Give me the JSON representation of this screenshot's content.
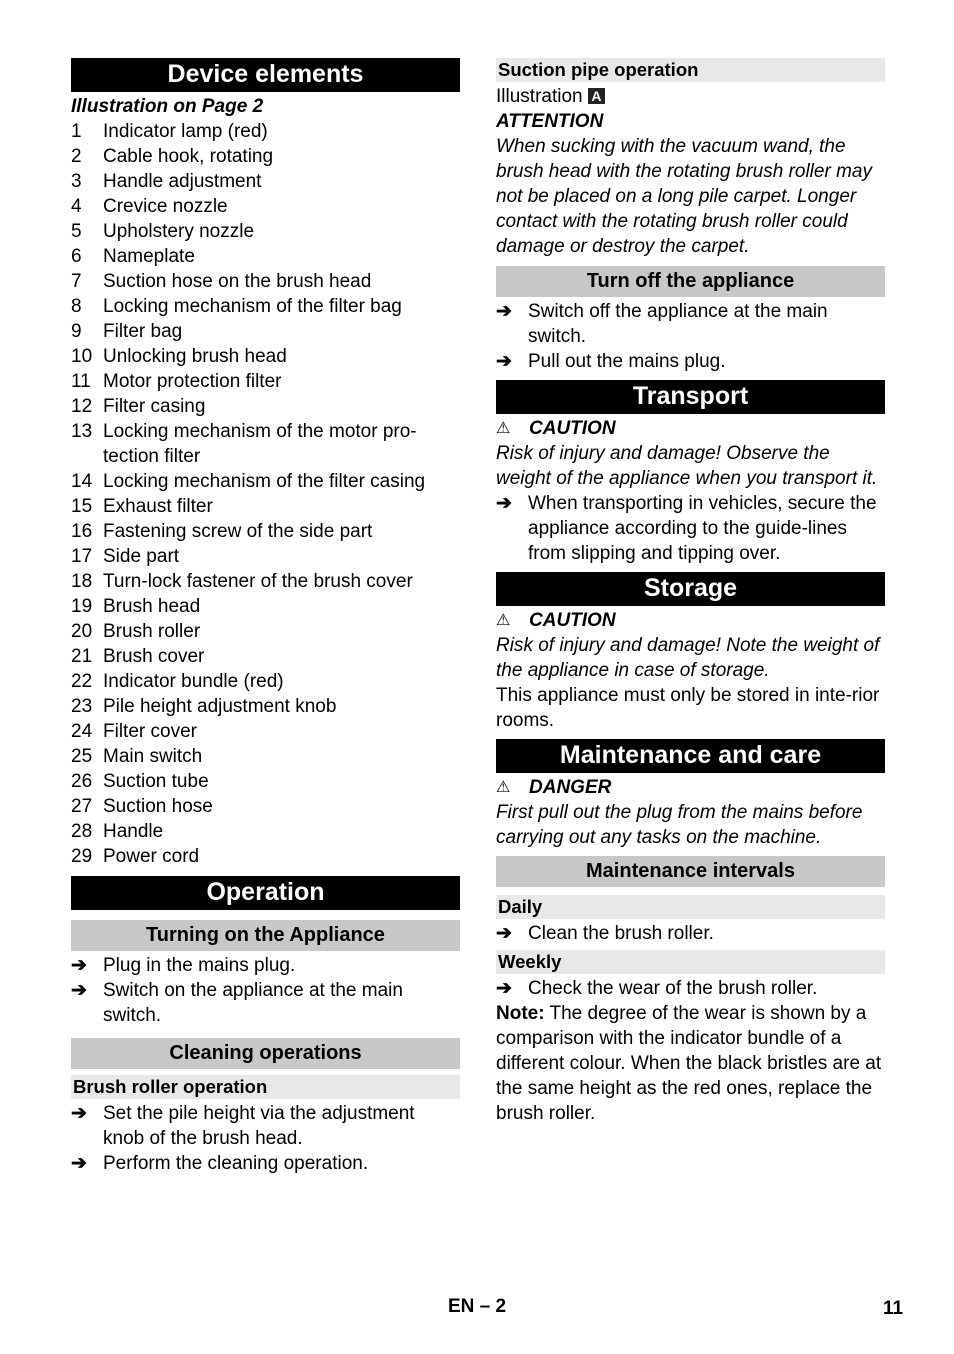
{
  "left": {
    "device_elements": {
      "title": "Device elements",
      "subtitle": "Illustration on Page 2",
      "items": [
        {
          "n": "1",
          "t": "Indicator lamp (red)"
        },
        {
          "n": "2",
          "t": "Cable hook, rotating"
        },
        {
          "n": "3",
          "t": "Handle adjustment"
        },
        {
          "n": "4",
          "t": "Crevice nozzle"
        },
        {
          "n": "5",
          "t": "Upholstery nozzle"
        },
        {
          "n": "6",
          "t": "Nameplate"
        },
        {
          "n": "7",
          "t": "Suction hose on the brush head"
        },
        {
          "n": "8",
          "t": "Locking mechanism of the filter bag"
        },
        {
          "n": "9",
          "t": "Filter bag"
        },
        {
          "n": "10",
          "t": "Unlocking brush head"
        },
        {
          "n": "11",
          "t": "Motor protection filter"
        },
        {
          "n": "12",
          "t": "Filter casing"
        },
        {
          "n": "13",
          "t": "Locking mechanism of the motor pro-tection filter"
        },
        {
          "n": "14",
          "t": "Locking mechanism of the filter casing"
        },
        {
          "n": "15",
          "t": "Exhaust filter"
        },
        {
          "n": "16",
          "t": "Fastening screw of the side part"
        },
        {
          "n": "17",
          "t": "Side part"
        },
        {
          "n": "18",
          "t": "Turn-lock fastener of the brush cover"
        },
        {
          "n": "19",
          "t": "Brush head"
        },
        {
          "n": "20",
          "t": "Brush roller"
        },
        {
          "n": "21",
          "t": "Brush cover"
        },
        {
          "n": "22",
          "t": "Indicator bundle (red)"
        },
        {
          "n": "23",
          "t": "Pile height adjustment knob"
        },
        {
          "n": "24",
          "t": "Filter cover"
        },
        {
          "n": "25",
          "t": "Main switch"
        },
        {
          "n": "26",
          "t": "Suction tube"
        },
        {
          "n": "27",
          "t": "Suction hose"
        },
        {
          "n": "28",
          "t": "Handle"
        },
        {
          "n": "29",
          "t": "Power cord"
        }
      ]
    },
    "operation": {
      "title": "Operation",
      "turning_on": {
        "title": "Turning on the Appliance",
        "steps": [
          "Plug in the mains plug.",
          "Switch on the appliance at the main switch."
        ]
      },
      "cleaning": {
        "title": "Cleaning operations",
        "brush_roller": {
          "title": "Brush roller operation",
          "steps": [
            "Set the pile height via the adjustment knob of the brush head.",
            "Perform the cleaning operation."
          ]
        }
      }
    }
  },
  "right": {
    "suction_pipe": {
      "title": "Suction pipe operation",
      "illustration_label": "Illustration",
      "illustration_ref": "A",
      "attention_label": "ATTENTION",
      "attention_text": "When sucking with the vacuum wand, the brush head with the rotating brush roller may not be placed on a long pile carpet. Longer contact with the rotating brush roller could damage or destroy the carpet."
    },
    "turn_off": {
      "title": "Turn off the appliance",
      "steps": [
        "Switch off the appliance at the main switch.",
        "Pull out the mains plug."
      ]
    },
    "transport": {
      "title": "Transport",
      "warning_label": "CAUTION",
      "warning_text": "Risk of injury and damage! Observe the weight of the appliance when you transport it.",
      "steps": [
        "When transporting in vehicles, secure the appliance according to the guide-lines from slipping and tipping over."
      ]
    },
    "storage": {
      "title": "Storage",
      "warning_label": "CAUTION",
      "warning_text": "Risk of injury and damage! Note the weight of the appliance in case of storage.",
      "text": "This appliance must only be stored in inte-rior rooms."
    },
    "maintenance": {
      "title": "Maintenance and care",
      "warning_label": "DANGER",
      "warning_text": "First pull out the plug from the mains before carrying out any tasks on the machine.",
      "intervals": {
        "title": "Maintenance intervals",
        "daily": {
          "title": "Daily",
          "steps": [
            "Clean the brush roller."
          ]
        },
        "weekly": {
          "title": "Weekly",
          "steps": [
            "Check the wear of the brush roller."
          ]
        },
        "note_label": "Note:",
        "note_text": " The degree of the wear is shown by a comparison with the indicator bundle of a different colour. When the black bristles are at the same height as the red ones, replace the brush roller."
      }
    }
  },
  "footer": {
    "lang": "EN – 2",
    "page": "11"
  },
  "glyphs": {
    "arrow": "➔",
    "warning": "⚠"
  }
}
